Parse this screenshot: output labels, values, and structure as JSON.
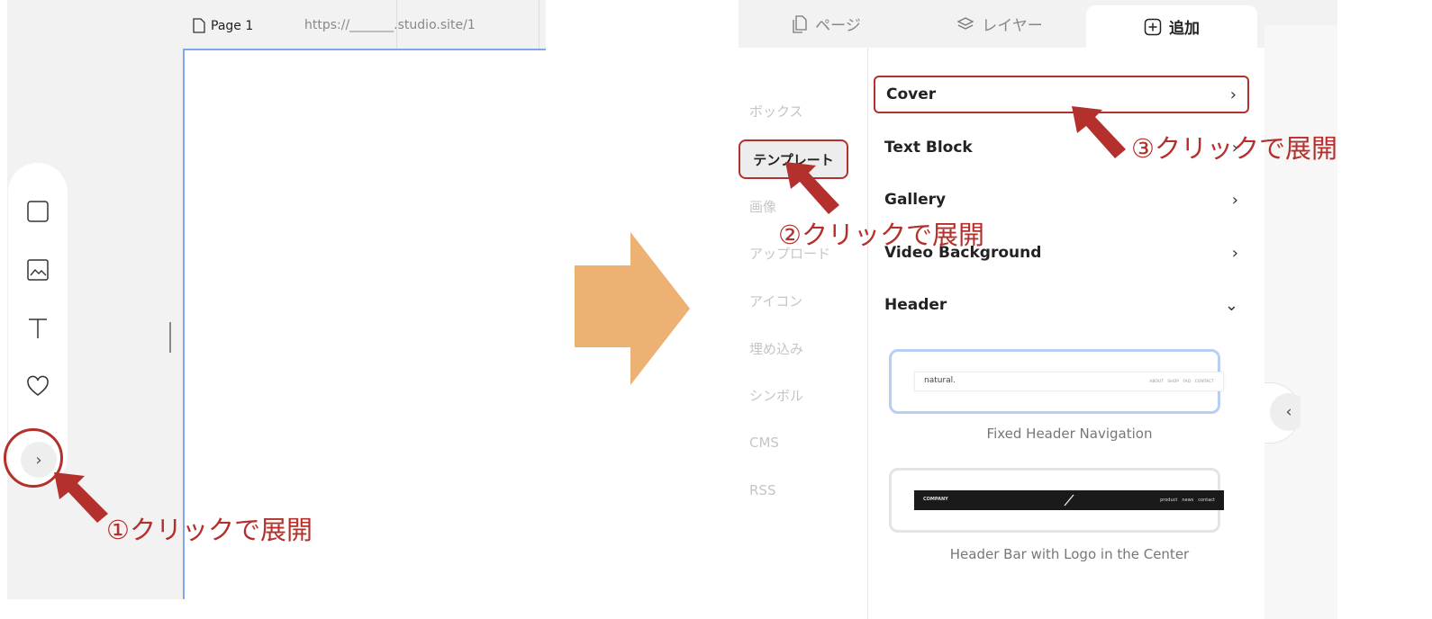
{
  "editor": {
    "page_tab": "Page 1",
    "page_url": "https://_______.studio.site/1",
    "tools": [
      "box-icon",
      "image-icon",
      "text-icon",
      "heart-icon"
    ],
    "expand_icon": "›"
  },
  "annotations": {
    "step1": "①クリックで展開",
    "step2": "②クリックで展開",
    "step3": "③クリックで展開",
    "color": "#b3302c"
  },
  "arrow_color": "#ecb173",
  "panel": {
    "tabs": [
      {
        "label": "ページ",
        "icon": "pages-icon"
      },
      {
        "label": "レイヤー",
        "icon": "layers-icon"
      },
      {
        "label": "追加",
        "icon": "add-icon",
        "active": true
      }
    ],
    "categories": [
      "ボックス",
      "テンプレート",
      "画像",
      "アップロード",
      "アイコン",
      "埋め込み",
      "シンボル",
      "CMS",
      "RSS"
    ],
    "active_category": "テンプレート",
    "templates": [
      {
        "label": "Cover",
        "icon": "›"
      },
      {
        "label": "Text Block",
        "icon": "›"
      },
      {
        "label": "Gallery",
        "icon": "›"
      },
      {
        "label": "Video Background",
        "icon": "›"
      },
      {
        "label": "Header",
        "icon": "⌄"
      }
    ],
    "previews": [
      {
        "caption": "Fixed Header Navigation",
        "logo": "natural.",
        "nav": "ABOUT　SHOP　FAQ　CONTACT"
      },
      {
        "caption": "Header Bar with Logo in the Center",
        "logo": "COMPANY",
        "nav": "product　news　contact"
      }
    ],
    "collapse_icon": "‹"
  }
}
